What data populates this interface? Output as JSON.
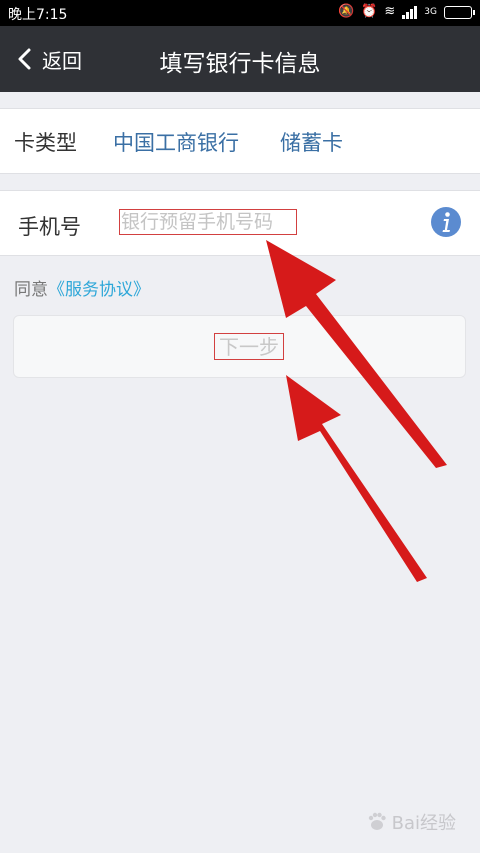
{
  "status_bar": {
    "time": "晚上7:15",
    "network": "3G"
  },
  "nav": {
    "back_label": "返回",
    "title": "填写银行卡信息"
  },
  "card_row": {
    "label": "卡类型",
    "bank": "中国工商银行",
    "card_type": "储蓄卡"
  },
  "phone_row": {
    "label": "手机号",
    "placeholder": "银行预留手机号码",
    "value": ""
  },
  "agreement": {
    "prefix": "同意",
    "link": "《服务协议》"
  },
  "next_button": {
    "label": "下一步"
  },
  "watermark": {
    "text": "Bai经验"
  },
  "colors": {
    "nav_bg": "#2f3136",
    "page_bg": "#eeeff3",
    "bank_text": "#3a6fa4",
    "link": "#2ea7d8",
    "info_icon": "#5b8bd0",
    "annotation_red": "#d61a1a"
  }
}
